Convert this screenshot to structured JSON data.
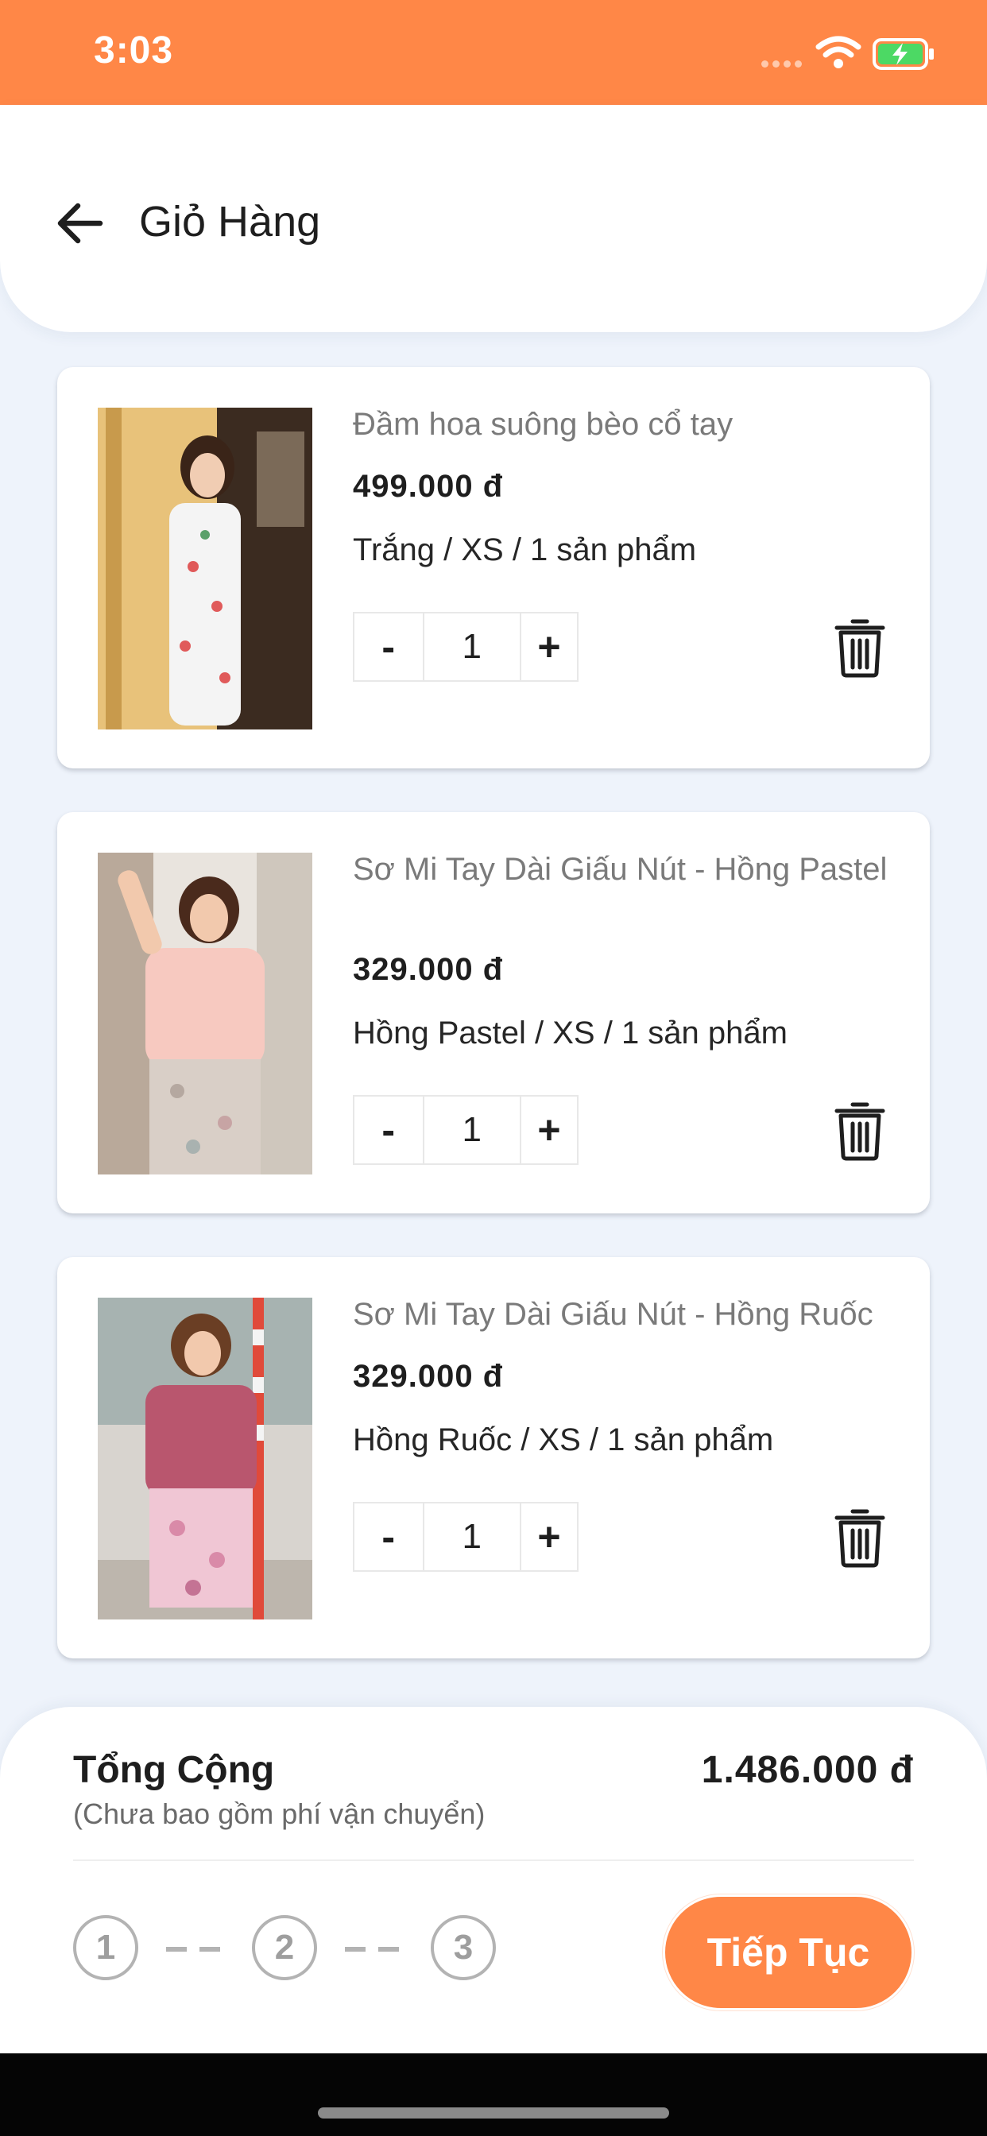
{
  "status_bar": {
    "time": "3:03",
    "icons": [
      "signal-dots-icon",
      "wifi-icon",
      "battery-charging-icon"
    ],
    "background_color": "#ff8747"
  },
  "header": {
    "back_icon": "arrow-left-icon",
    "title": "Giỏ Hàng"
  },
  "cart": {
    "items": [
      {
        "name": "Đầm hoa suông bèo cổ tay",
        "price": "499.000 đ",
        "variant": "Trắng / XS / 1 sản phẩm",
        "quantity": "1",
        "minus_label": "-",
        "plus_label": "+",
        "image": "floral-dress-photo",
        "delete_icon": "trash-icon"
      },
      {
        "name": "Sơ Mi Tay Dài Giấu Nút - Hồng Pastel",
        "price": "329.000 đ",
        "variant": "Hồng Pastel / XS / 1 sản phẩm",
        "quantity": "1",
        "minus_label": "-",
        "plus_label": "+",
        "image": "pastel-pink-shirt-photo",
        "delete_icon": "trash-icon"
      },
      {
        "name": "Sơ Mi Tay Dài Giấu Nút - Hồng Ruốc",
        "price": "329.000 đ",
        "variant": "Hồng Ruốc / XS / 1 sản phẩm",
        "quantity": "1",
        "minus_label": "-",
        "plus_label": "+",
        "image": "dusty-pink-shirt-photo",
        "delete_icon": "trash-icon"
      }
    ]
  },
  "footer": {
    "total_label": "Tổng Cộng",
    "total_note": "(Chưa bao gồm phí vận chuyển)",
    "total_amount": "1.486.000 đ",
    "steps": [
      "1",
      "2",
      "3"
    ],
    "continue_label": "Tiếp Tục",
    "accent_color": "#ff8747"
  }
}
